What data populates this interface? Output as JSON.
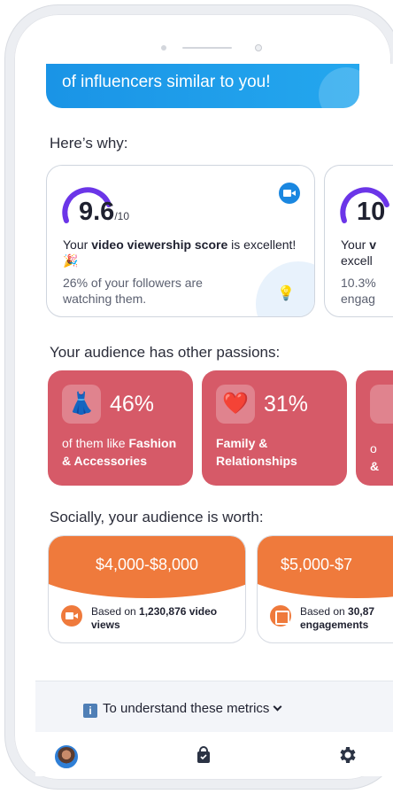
{
  "banner": {
    "text": "of influencers similar to you!"
  },
  "why": {
    "title": "Here’s why:",
    "cards": [
      {
        "score": "9.6",
        "max": "/10",
        "main_prefix": "Your ",
        "main_bold": "video viewership score",
        "main_suffix": " is excellent! 🎉",
        "sub": "26% of your followers are watching them.",
        "icon": "video-camera-icon"
      },
      {
        "score": "10",
        "max": "",
        "main_prefix": "Your ",
        "main_bold": "v",
        "main_suffix": " excell",
        "sub": "10.3% engag",
        "icon": "video-camera-icon"
      }
    ]
  },
  "passions": {
    "title": "Your audience has other passions:",
    "cards": [
      {
        "emoji": "👗",
        "pct": "46%",
        "desc_prefix": "of them like ",
        "desc_bold": "Fashion & Accessories"
      },
      {
        "emoji": "❤️",
        "pct": "31%",
        "desc_prefix": "",
        "desc_bold": "Family & Relationships"
      },
      {
        "emoji": "",
        "pct": "",
        "desc_prefix": "o",
        "desc_bold": "&"
      }
    ]
  },
  "worth": {
    "title": "Socially, your audience is worth:",
    "cards": [
      {
        "amount": "$4,000-$8,000",
        "icon": "video-icon",
        "text_prefix": "Based on ",
        "text_bold": "1,230,876 video views"
      },
      {
        "amount": "$5,000-$7",
        "icon": "image-icon",
        "text_prefix": "Based on ",
        "text_bold": "30,87 engagements"
      }
    ]
  },
  "metrics": {
    "label": "To understand these metrics",
    "info_glyph": "i"
  },
  "tabbar": {
    "items": [
      "avatar",
      "shopping-bag-icon",
      "gear-icon"
    ]
  },
  "colors": {
    "accent_blue": "#1a94e6",
    "passion_red": "#d65a68",
    "worth_orange": "#ef7a3c",
    "arc_purple": "#6b35e8"
  }
}
